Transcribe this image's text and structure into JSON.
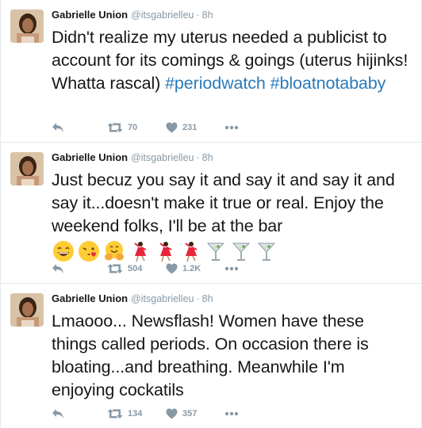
{
  "tweets": [
    {
      "name": "Gabrielle Union",
      "handle": "@itsgabrielleu",
      "time": "8h",
      "text": "Didn't realize my uterus needed a publicist to account for its comings & goings (uterus hijinks! Whatta rascal) ",
      "hashtags": [
        "#periodwatch",
        "#bloatnotababy"
      ],
      "retweets": "70",
      "likes": "231"
    },
    {
      "name": "Gabrielle Union",
      "handle": "@itsgabrielleu",
      "time": "8h",
      "text": "Just becuz you say it and say it and say it and say it...doesn't make it true or real. Enjoy the weekend folks, I'll be at the bar",
      "emojis": [
        "grinning-face",
        "face-blowing-kiss",
        "hugging-face",
        "dancer",
        "dancer",
        "dancer",
        "cocktail-glass",
        "cocktail-glass",
        "cocktail-glass"
      ],
      "retweets": "504",
      "likes": "1.2K"
    },
    {
      "name": "Gabrielle Union",
      "handle": "@itsgabrielleu",
      "time": "8h",
      "text": "Lmaooo... Newsflash! Women have these things called periods. On occasion there is bloating...and breathing. Meanwhile I'm enjoying cockatils",
      "retweets": "134",
      "likes": "357"
    }
  ],
  "separator": "·",
  "colors": {
    "hashtag": "#2b7bb9",
    "meta": "#8899a6",
    "divider": "#e1e8ed"
  }
}
